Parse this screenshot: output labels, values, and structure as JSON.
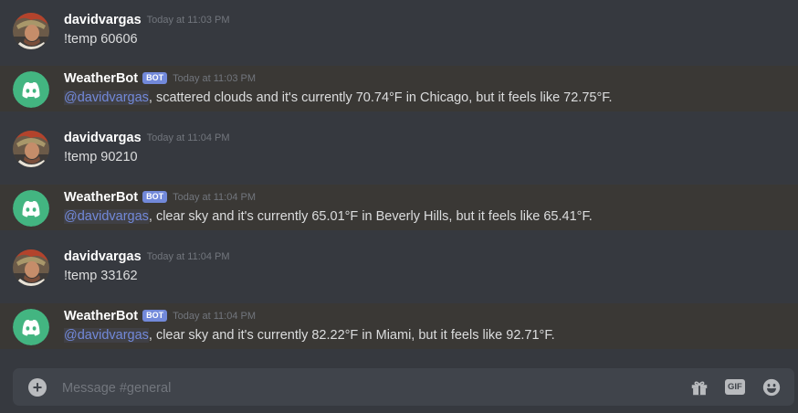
{
  "messages": [
    {
      "author": "davidvargas",
      "timestamp": "Today at 11:03 PM",
      "text": "!temp 60606",
      "is_bot": false
    },
    {
      "author": "WeatherBot",
      "badge": "BOT",
      "timestamp": "Today at 11:03 PM",
      "mention": "@davidvargas",
      "text": ", scattered clouds and it's currently 70.74°F in Chicago, but it feels like 72.75°F.",
      "is_bot": true
    },
    {
      "author": "davidvargas",
      "timestamp": "Today at 11:04 PM",
      "text": "!temp 90210",
      "is_bot": false
    },
    {
      "author": "WeatherBot",
      "badge": "BOT",
      "timestamp": "Today at 11:04 PM",
      "mention": "@davidvargas",
      "text": ", clear sky and it's currently 65.01°F in Beverly Hills, but it feels like 65.41°F.",
      "is_bot": true
    },
    {
      "author": "davidvargas",
      "timestamp": "Today at 11:04 PM",
      "text": "!temp 33162",
      "is_bot": false
    },
    {
      "author": "WeatherBot",
      "badge": "BOT",
      "timestamp": "Today at 11:04 PM",
      "mention": "@davidvargas",
      "text": ", clear sky and it's currently 82.22°F in Miami, but it feels like 92.71°F.",
      "is_bot": true
    }
  ],
  "composer": {
    "placeholder": "Message #general",
    "gif_label": "GIF",
    "icons": [
      "plus-icon",
      "gift-icon",
      "gif-icon",
      "emoji-icon"
    ]
  },
  "colors": {
    "background": "#36393f",
    "bot_row_highlight": "#3a3835",
    "bot_avatar": "#43b581",
    "bot_badge": "#7289da",
    "mention": "#7289da",
    "username": "#ffffff",
    "timestamp": "#72767d",
    "message_text": "#dcddde",
    "composer_bg": "#40444b"
  }
}
